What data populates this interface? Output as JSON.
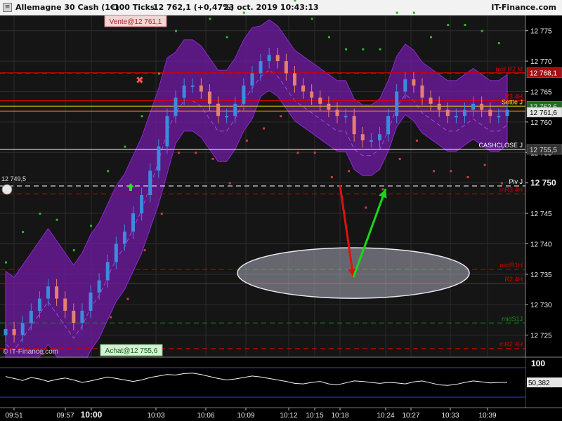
{
  "header": {
    "instrument": "Allemagne 30 Cash (1€)",
    "interval": "100 Ticks",
    "quote": "12 762,1 (+0,47%)",
    "datetime": "23 oct. 2019 10:43:13",
    "brand": "IT-Finance.com"
  },
  "watermark": "© IT-Finance.com",
  "orders": {
    "sell": "Vente@12 761,1",
    "buy": "Achat@12 755,6"
  },
  "colors": {
    "background": "#000000",
    "envelope": "#6a1a9a",
    "candle_up": "#3d8be0",
    "candle_down": "#e87f6e",
    "arrow_down": "#e01010",
    "arrow_up": "#18d818",
    "resistance": "#e00000",
    "support_green": "#1c8a1c"
  },
  "chart_data": [
    {
      "type": "line",
      "title": "Allemagne 30 Cash (1€) 100 Ticks",
      "xlabel": "",
      "ylabel": "",
      "ylim": [
        12721.5,
        12777.5
      ],
      "grid": true,
      "x_ticks": [
        "09:51",
        "09:57",
        "10:00",
        "10:03",
        "10:06",
        "10:09",
        "10:12",
        "10:15",
        "10:18",
        "10:24",
        "10:27",
        "10:33",
        "10:39"
      ],
      "y_ticks": [
        12725,
        12730,
        12735,
        12740,
        12745,
        12750,
        12755,
        12760,
        12765,
        12770,
        12775
      ],
      "y_tick_labels": [
        "12 725",
        "12 730",
        "12 735",
        "12 740",
        "12 745",
        "12 750",
        "12 755",
        "12 760",
        "12 765",
        "12 770",
        "12 775"
      ],
      "series": [
        {
          "values": [
            12726,
            12725,
            12727,
            12729,
            12731,
            12733,
            12731,
            12729,
            12727,
            12729,
            12732,
            12734,
            12737,
            12740,
            12742,
            12745,
            12748,
            12752,
            12756,
            12761,
            12764,
            12766,
            12766,
            12765,
            12763,
            12761,
            12761,
            12763,
            12766,
            12768,
            12770,
            12771,
            12770,
            12768,
            12766,
            12765,
            12764,
            12763,
            12762,
            12761,
            12761,
            12758,
            12757,
            12757,
            12758,
            12761,
            12765,
            12767,
            12766,
            12764,
            12763,
            12762,
            12761,
            12761,
            12762,
            12763,
            12762,
            12761,
            12761,
            12762
          ]
        }
      ],
      "levels": [
        {
          "label": "mid R2 M",
          "value": 12768.0,
          "color": "#d00000",
          "style": "dashed"
        },
        {
          "label": "",
          "value": 12768.1,
          "color": "#d00000",
          "style": "solid"
        },
        {
          "label": "R3 4H",
          "value": 12763.5,
          "color": "#e00000",
          "style": "solid"
        },
        {
          "label": "Settle J",
          "value": 12762.6,
          "color": "#e0e000",
          "style": "solid"
        },
        {
          "label": "",
          "value": 12761.8,
          "color": "#ff9900",
          "style": "solid"
        },
        {
          "label": "CASHCLOSE J",
          "value": 12755.5,
          "color": "#ffffff",
          "style": "solid"
        },
        {
          "label": "Piv J",
          "value": 12749.5,
          "color": "#ffffff",
          "style": "dashed"
        },
        {
          "label": "mR3 4H",
          "value": 12748.2,
          "color": "#d00000",
          "style": "dashed"
        },
        {
          "label": "midR1H",
          "value": 12735.8,
          "color": "#d00000",
          "style": "dashed"
        },
        {
          "label": "R2 4H",
          "value": 12733.5,
          "color": "#e00000",
          "style": "solid"
        },
        {
          "label": "midS1J",
          "value": 12727.0,
          "color": "#1c8a1c",
          "style": "dashed"
        },
        {
          "label": "mR2 4H",
          "value": 12722.8,
          "color": "#d00000",
          "style": "dashed"
        }
      ],
      "price_badges": [
        {
          "label": "12 768,1",
          "value": 12768.1
        },
        {
          "label": "12 762,6",
          "value": 12762.6
        },
        {
          "label": "12 761,6",
          "value": 12761.6
        },
        {
          "label": "12 755,5",
          "value": 12755.5
        }
      ],
      "left_price_label": "12 749,5",
      "annotations": [
        {
          "type": "arrow",
          "color": "red",
          "from": {
            "x": "10:18",
            "y": 12749.6
          },
          "to": {
            "x": "10:21",
            "y": 12734.5
          }
        },
        {
          "type": "arrow",
          "color": "green",
          "from": {
            "x": "10:21",
            "y": 12734.5
          },
          "to": {
            "x": "10:24",
            "y": 12749.0
          }
        },
        {
          "type": "ellipse",
          "center": {
            "x": "10:21",
            "y": 12735.2
          }
        }
      ]
    },
    {
      "type": "line",
      "title": "",
      "ylim": [
        0,
        100
      ],
      "y_ticks": [
        100
      ],
      "y_tick_labels": [
        "100"
      ],
      "last_value_label": "50,382",
      "series": [
        {
          "values": [
            62,
            58,
            54,
            60,
            57,
            52,
            56,
            59,
            55,
            50,
            53,
            57,
            61,
            58,
            55,
            52,
            55,
            60,
            63,
            66,
            65,
            68,
            69,
            66,
            62,
            58,
            55,
            57,
            60,
            63,
            61,
            58,
            55,
            52,
            48,
            47,
            50,
            52,
            47,
            45,
            49,
            53,
            52,
            50,
            48,
            50,
            49,
            47,
            51,
            53,
            49,
            45,
            44,
            46,
            50,
            53,
            51,
            49,
            50,
            50
          ]
        }
      ],
      "levels": [
        {
          "value": 80
        },
        {
          "value": 20
        }
      ]
    }
  ]
}
